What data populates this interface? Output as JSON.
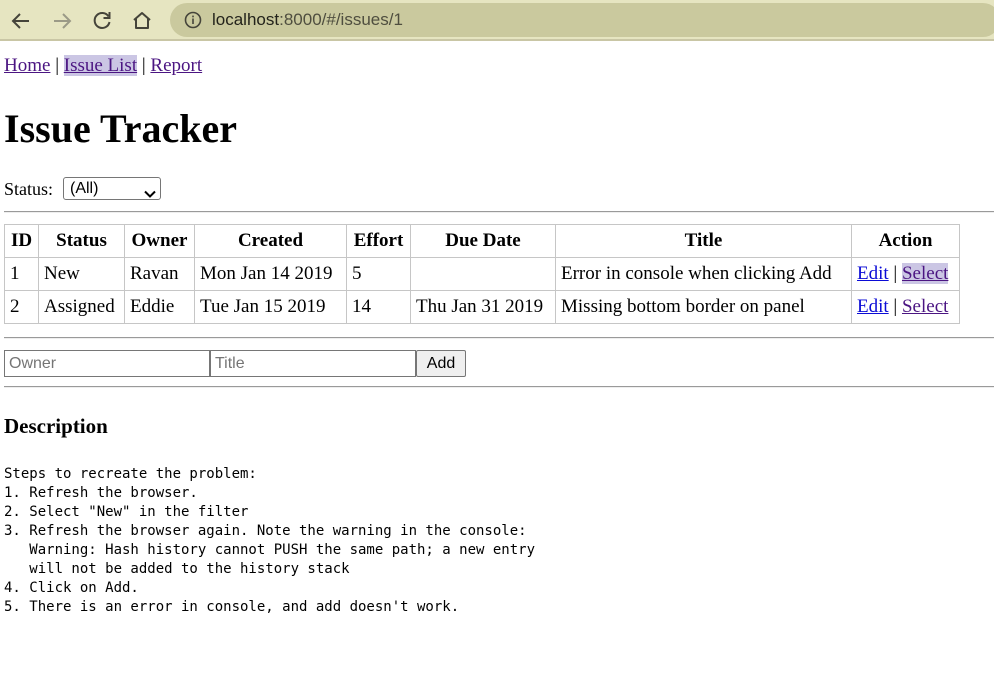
{
  "browser": {
    "url_host": "localhost",
    "url_path": ":8000/#/issues/1"
  },
  "nav": {
    "home": "Home",
    "issue_list": "Issue List",
    "report": "Report",
    "separator": "|"
  },
  "page_title": "Issue Tracker",
  "filter": {
    "label": "Status:",
    "selected": "(All)"
  },
  "table": {
    "headers": [
      "ID",
      "Status",
      "Owner",
      "Created",
      "Effort",
      "Due Date",
      "Title",
      "Action"
    ],
    "rows": [
      {
        "id": "1",
        "status": "New",
        "owner": "Ravan",
        "created": "Mon Jan 14 2019",
        "effort": "5",
        "due": "",
        "title": "Error in console when clicking Add",
        "edit": "Edit",
        "sep": "|",
        "select": "Select"
      },
      {
        "id": "2",
        "status": "Assigned",
        "owner": "Eddie",
        "created": "Tue Jan 15 2019",
        "effort": "14",
        "due": "Thu Jan 31 2019",
        "title": "Missing bottom border on panel",
        "edit": "Edit",
        "sep": "|",
        "select": "Select"
      }
    ]
  },
  "add_form": {
    "owner_placeholder": "Owner",
    "title_placeholder": "Title",
    "add_label": "Add"
  },
  "description": {
    "heading": "Description",
    "text": "Steps to recreate the problem:\n1. Refresh the browser.\n2. Select \"New\" in the filter\n3. Refresh the browser again. Note the warning in the console:\n   Warning: Hash history cannot PUSH the same path; a new entry\n   will not be added to the history stack\n4. Click on Add.\n5. There is an error in console, and add doesn't work."
  },
  "colors": {
    "toolbar_bg": "#e6e5c1",
    "urlbar_bg": "#cac99e",
    "link": "#4b1582",
    "active_highlight": "#cbc6e4"
  }
}
